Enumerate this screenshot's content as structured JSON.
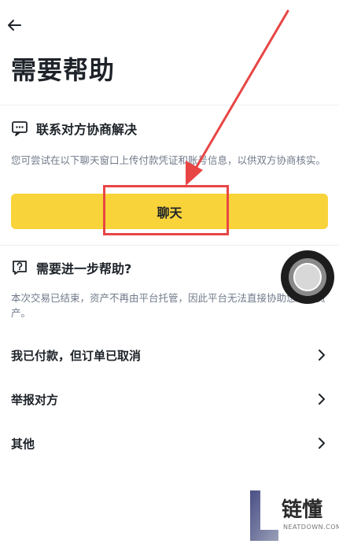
{
  "header": {
    "back_icon": "back-arrow-icon",
    "title": "需要帮助"
  },
  "negotiate": {
    "icon": "chat-bubble-icon",
    "heading": "联系对方协商解决",
    "description": "您可尝试在以下聊天窗口上传付款凭证和账号信息，以供双方协商核实。",
    "button_label": "聊天"
  },
  "more_help": {
    "icon": "question-icon",
    "heading": "需要进一步帮助?",
    "description": "本次交易已结束，资产不再由平台托管，因此平台无法直接协助您追回资产。"
  },
  "options": [
    {
      "label": "我已付款，但订单已取消"
    },
    {
      "label": "举报对方"
    },
    {
      "label": "其他"
    }
  ],
  "watermark": {
    "cn": "链懂",
    "en": "NEATDOWN.COM"
  },
  "colors": {
    "accent": "#f8d33a",
    "annotation": "#e84545",
    "muted_text": "#707a8a"
  }
}
